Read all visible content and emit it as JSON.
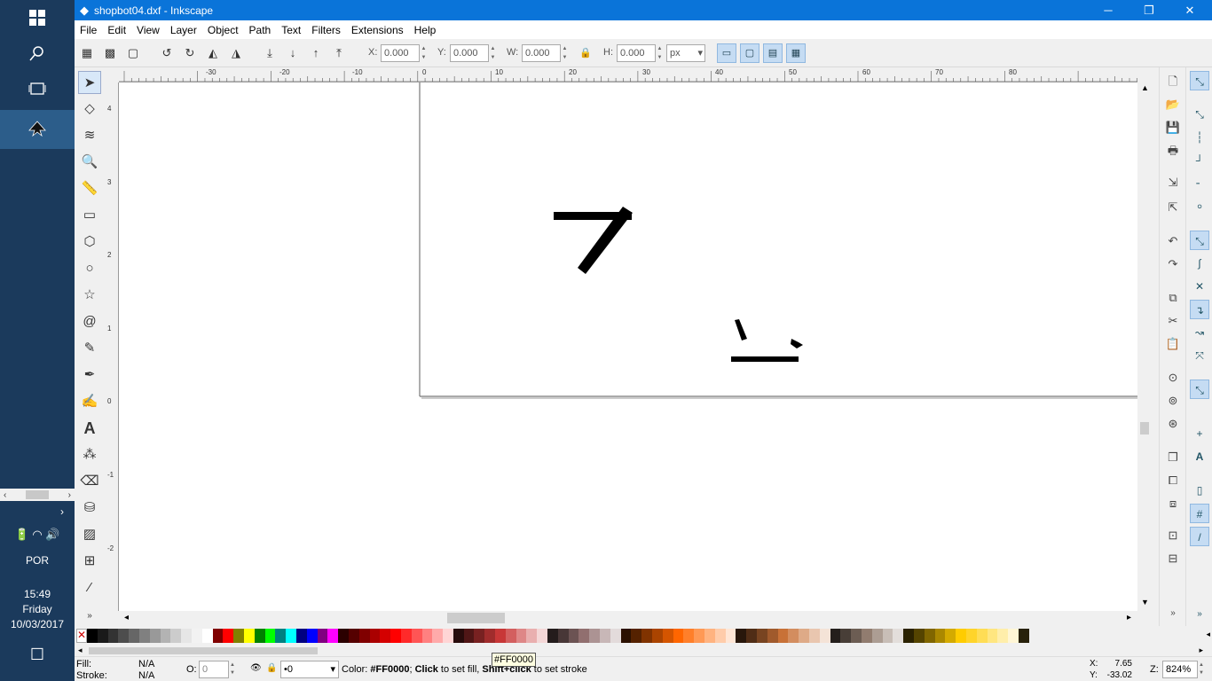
{
  "window": {
    "title": "shopbot04.dxf - Inkscape",
    "minimize": "─",
    "restore": "❐",
    "close": "✕"
  },
  "menu": [
    "File",
    "Edit",
    "View",
    "Layer",
    "Object",
    "Path",
    "Text",
    "Filters",
    "Extensions",
    "Help"
  ],
  "toolbar": {
    "x_label": "X:",
    "x_value": "0.000",
    "y_label": "Y:",
    "y_value": "0.000",
    "w_label": "W:",
    "w_value": "0.000",
    "h_label": "H:",
    "h_value": "0.000",
    "unit": "px"
  },
  "ruler_h": [
    "-30",
    "-20",
    "-10",
    "0",
    "10",
    "20",
    "30",
    "40",
    "50",
    "60",
    "70",
    "80"
  ],
  "ruler_v": [
    "4",
    "3",
    "2",
    "1",
    "0",
    "-1",
    "-2"
  ],
  "taskbar": {
    "lang": "POR",
    "time": "15:49",
    "day": "Friday",
    "date": "10/03/2017"
  },
  "palette": [
    "#000000",
    "#1a1a1a",
    "#333333",
    "#4d4d4d",
    "#666666",
    "#808080",
    "#999999",
    "#b3b3b3",
    "#cccccc",
    "#e6e6e6",
    "#f2f2f2",
    "#ffffff",
    "#800000",
    "#ff0000",
    "#808000",
    "#ffff00",
    "#008000",
    "#00ff00",
    "#008080",
    "#00ffff",
    "#000080",
    "#0000ff",
    "#800080",
    "#ff00ff",
    "#2b0000",
    "#550000",
    "#800000",
    "#aa0000",
    "#d40000",
    "#ff0000",
    "#ff2a2a",
    "#ff5555",
    "#ff8080",
    "#ffaaaa",
    "#ffd5d5",
    "#280b0b",
    "#501616",
    "#782121",
    "#a02c2c",
    "#c83737",
    "#d35f5f",
    "#de8787",
    "#e9afaf",
    "#f4d7d7",
    "#241c1c",
    "#483737",
    "#6c5353",
    "#916f6f",
    "#ac9393",
    "#c8b7b7",
    "#e3dbdb",
    "#2b1100",
    "#552200",
    "#803300",
    "#aa4400",
    "#d45500",
    "#ff6600",
    "#ff7f2a",
    "#ff9955",
    "#ffb380",
    "#ffccaa",
    "#ffe6d5",
    "#28170b",
    "#502d16",
    "#784421",
    "#a05a2c",
    "#c87137",
    "#d38d5f",
    "#deaa87",
    "#e9c6af",
    "#f4e3d7",
    "#241f1c",
    "#483e37",
    "#6c5d53",
    "#917c6f",
    "#ac9d93",
    "#c8beb7",
    "#e3dedb",
    "#2b2200",
    "#554400",
    "#806600",
    "#aa8800",
    "#d4aa00",
    "#ffcc00",
    "#ffd42a",
    "#ffdd55",
    "#ffe680",
    "#ffeeaa",
    "#fff6d5",
    "#28220b"
  ],
  "status": {
    "fill_label": "Fill:",
    "fill_value": "N/A",
    "stroke_label": "Stroke:",
    "stroke_value": "N/A",
    "opacity_label": "O:",
    "opacity_value": "0",
    "layer_value": "•0",
    "message_pre": "Color: ",
    "message_color": "#FF0000",
    "message_mid": "; ",
    "message_click": "Click",
    "message_fill": " to set fill, ",
    "message_shift": "Shift+click",
    "message_stroke": " to set stroke",
    "tooltip": "#FF0000",
    "x_label": "X:",
    "x_value": "7.65",
    "y_label": "Y:",
    "y_value": "-33.02",
    "zoom_label": "Z:",
    "zoom_value": "824%"
  }
}
